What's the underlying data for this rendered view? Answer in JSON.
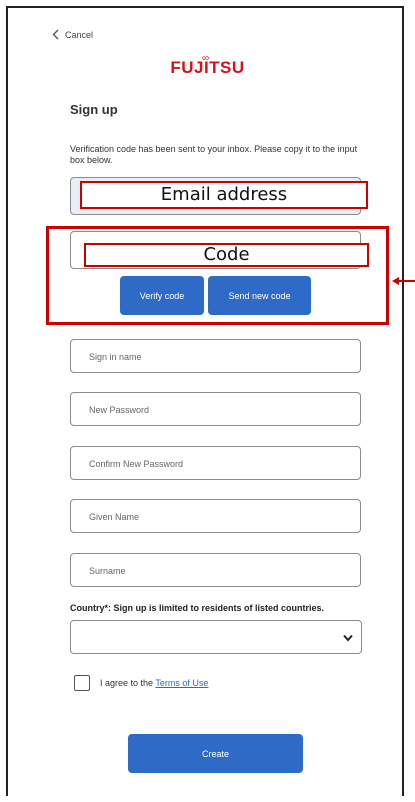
{
  "header": {
    "cancel_label": "Cancel",
    "logo_text": "FUJITSU",
    "logo_symbol": "∞"
  },
  "form": {
    "title": "Sign up",
    "verification_message": "Verification code has been sent to your inbox. Please copy it to the input box below.",
    "email_annotation": "Email address",
    "code_annotation": "Code",
    "verify_button": "Verify code",
    "send_new_code_button": "Send new code",
    "fields": {
      "sign_in_name": "Sign in name",
      "new_password": "New Password",
      "confirm_password": "Confirm New Password",
      "given_name": "Given Name",
      "surname": "Surname"
    },
    "country_label": "Country*: Sign up is limited to residents of listed countries.",
    "country_value": "",
    "agree_text": "I agree to the",
    "terms_link": "Terms of Use",
    "create_button": "Create"
  },
  "colors": {
    "accent": "#2e6bc6",
    "annotation": "#cc0000",
    "brand": "#d5121b"
  },
  "icons": {
    "back": "chevron-left-icon",
    "dropdown": "chevron-down-icon",
    "annotation_arrow": "arrow-left-icon"
  }
}
